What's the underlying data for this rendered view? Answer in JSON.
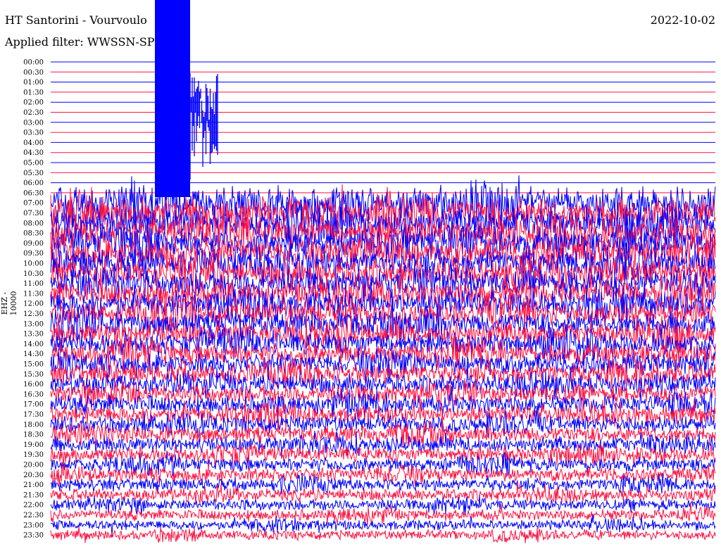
{
  "header": {
    "title": "HT Santorini - Vourvoulo",
    "filter": "Applied filter: WWSSN-SP",
    "date": "2022-10-02"
  },
  "chart_data": {
    "type": "helicorder",
    "title": "HT Santorini - Vourvoulo",
    "ylabel": "EHZ - 10000",
    "row_minutes": 30,
    "row_labels": [
      "00:00",
      "00:30",
      "01:00",
      "01:30",
      "02:00",
      "02:30",
      "03:00",
      "03:30",
      "04:00",
      "04:30",
      "05:00",
      "05:30",
      "06:00",
      "06:30",
      "07:00",
      "07:30",
      "08:00",
      "08:30",
      "09:00",
      "09:30",
      "10:00",
      "10:30",
      "11:00",
      "11:30",
      "12:00",
      "12:30",
      "13:00",
      "13:30",
      "14:00",
      "14:30",
      "15:00",
      "15:30",
      "16:00",
      "16:30",
      "17:00",
      "17:30",
      "18:00",
      "18:30",
      "19:00",
      "19:30",
      "20:00",
      "20:30",
      "21:00",
      "21:30",
      "22:00",
      "22:30",
      "23:00",
      "23:30"
    ],
    "trace_colors": [
      "#0000ff",
      "#ff1040"
    ],
    "data_start_row": "06:30",
    "large_event": {
      "row": "00:00",
      "start_minute": 4.5,
      "end_minute": 6.5
    }
  }
}
